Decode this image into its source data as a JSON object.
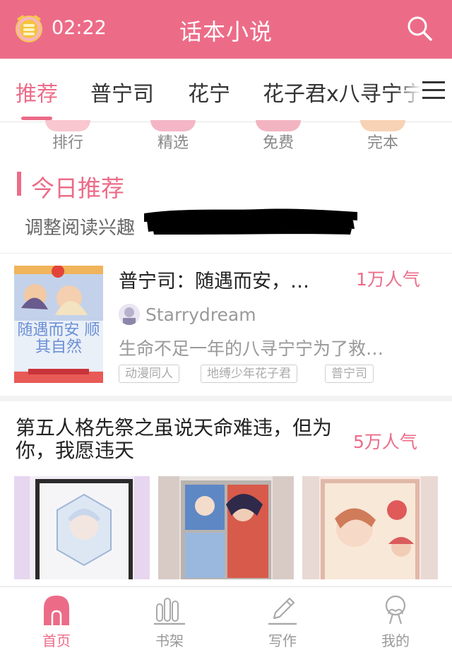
{
  "status": {
    "time": "02:22"
  },
  "header": {
    "title": "话本小说"
  },
  "tabs": [
    {
      "label": "推荐",
      "active": true
    },
    {
      "label": "普宁司"
    },
    {
      "label": "花宁"
    },
    {
      "label": "花子君x八寻宁宁"
    }
  ],
  "categories": [
    {
      "label": "排行",
      "color": "#f8c7cf"
    },
    {
      "label": "精选",
      "color": "#f4b6c6"
    },
    {
      "label": "免费",
      "color": "#f3b4c2"
    },
    {
      "label": "完本",
      "color": "#f7d2b5"
    }
  ],
  "section": {
    "title": "今日推荐",
    "adjust_text": "调整阅读兴趣"
  },
  "book1": {
    "title": "普宁司：随遇而安，…",
    "popularity": "1万人气",
    "author": "Starrydream",
    "description": "生命不足一年的八寻宁宁为了救…",
    "tags": [
      "动漫同人",
      "地缚少年花子君",
      "普宁司"
    ],
    "cover_text": "随遇而安 顺其自然"
  },
  "book2": {
    "title": "第五人格先祭之虽说天命难违，但为你，我愿违天",
    "popularity": "5万人气"
  },
  "bottom_nav": [
    {
      "label": "首页",
      "icon": "home-icon",
      "active": true
    },
    {
      "label": "书架",
      "icon": "bookshelf-icon"
    },
    {
      "label": "写作",
      "icon": "pencil-icon"
    },
    {
      "label": "我的",
      "icon": "profile-icon"
    }
  ],
  "colors": {
    "accent": "#ec6c88",
    "header_bg": "#ec6c88"
  }
}
